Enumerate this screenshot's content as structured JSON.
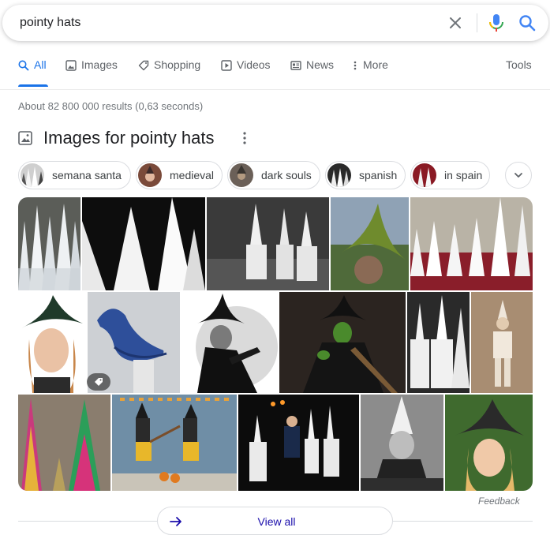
{
  "search": {
    "query": "pointy hats"
  },
  "tabs": [
    {
      "label": "All",
      "icon": "search-icon",
      "active": true
    },
    {
      "label": "Images",
      "icon": "image-icon"
    },
    {
      "label": "Shopping",
      "icon": "tag-icon"
    },
    {
      "label": "Videos",
      "icon": "play-icon"
    },
    {
      "label": "News",
      "icon": "news-icon"
    },
    {
      "label": "More",
      "icon": "more-vert-icon"
    }
  ],
  "tools_label": "Tools",
  "results_stats": "About 82 800 000 results (0,63 seconds)",
  "images_section": {
    "title": "Images for pointy hats",
    "chips": [
      {
        "label": "semana santa",
        "icon": "semana-santa-thumbnail"
      },
      {
        "label": "medieval",
        "icon": "medieval-thumbnail"
      },
      {
        "label": "dark souls",
        "icon": "dark-souls-thumbnail"
      },
      {
        "label": "spanish",
        "icon": "spanish-thumbnail"
      },
      {
        "label": "in spain",
        "icon": "in-spain-thumbnail"
      }
    ]
  },
  "feedback_label": "Feedback",
  "view_all_label": "View all",
  "colors": {
    "accent": "#1a73e8",
    "link": "#1a0dab",
    "muted": "#70757a",
    "border": "#dadce0",
    "mic_red": "#ea4335",
    "mic_yellow": "#fbbc04",
    "mic_green": "#34a853",
    "mic_blue": "#4285f4"
  }
}
